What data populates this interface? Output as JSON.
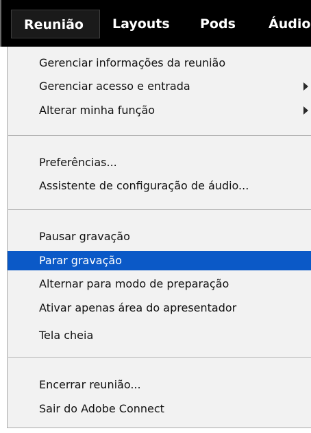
{
  "menubar": {
    "items": [
      {
        "label": "Reunião"
      },
      {
        "label": "Layouts"
      },
      {
        "label": "Pods"
      },
      {
        "label": "Áudio"
      }
    ]
  },
  "dropdown": {
    "items": [
      {
        "label": "Gerenciar informações da reunião"
      },
      {
        "label": "Gerenciar acesso e entrada",
        "has_submenu": true
      },
      {
        "label": "Alterar minha função",
        "has_submenu": true
      },
      {
        "label": "Preferências..."
      },
      {
        "label": "Assistente de configuração de áudio..."
      },
      {
        "label": "Pausar gravação"
      },
      {
        "label": "Parar gravação",
        "highlighted": true
      },
      {
        "label": "Alternar para modo de preparação"
      },
      {
        "label": "Ativar apenas área do apresentador"
      },
      {
        "label": "Tela cheia"
      },
      {
        "label": "Encerrar reunião..."
      },
      {
        "label": "Sair do Adobe Connect"
      }
    ]
  },
  "colors": {
    "menubar_bg": "#000000",
    "highlight": "#0b59c7",
    "dropdown_bg": "#f2f2f2"
  }
}
